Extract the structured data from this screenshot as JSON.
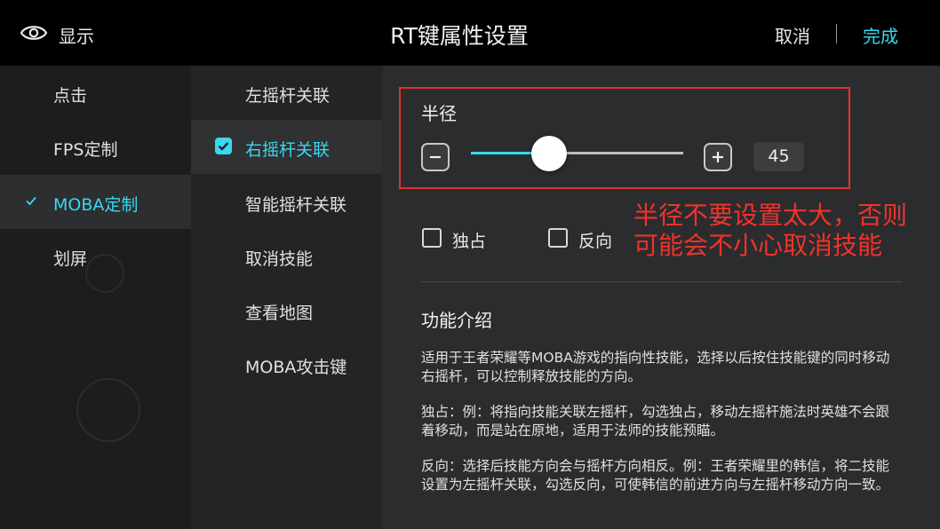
{
  "header": {
    "display_label": "显示",
    "title": "RT键属性设置",
    "cancel_label": "取消",
    "done_label": "完成",
    "accent_color": "#38d8ef"
  },
  "mode_list": {
    "items": [
      {
        "label": "点击",
        "selected": false
      },
      {
        "label": "FPS定制",
        "selected": false
      },
      {
        "label": "MOBA定制",
        "selected": true
      },
      {
        "label": "划屏",
        "selected": false
      }
    ]
  },
  "binding_list": {
    "items": [
      {
        "label": "左摇杆关联",
        "selected": false
      },
      {
        "label": "右摇杆关联",
        "selected": true
      },
      {
        "label": "智能摇杆关联",
        "selected": false
      },
      {
        "label": "取消技能",
        "selected": false
      },
      {
        "label": "查看地图",
        "selected": false
      },
      {
        "label": "MOBA攻击键",
        "selected": false
      }
    ]
  },
  "radius": {
    "label": "半径",
    "value": "45",
    "slider_fraction": 0.37,
    "minus_icon": "minus-icon",
    "plus_icon": "plus-icon"
  },
  "options": {
    "exclusive_label": "独占",
    "exclusive_checked": false,
    "reverse_label": "反向",
    "reverse_checked": false
  },
  "annotation": {
    "line1": "半径不要设置太大，否则",
    "line2": "可能会不小心取消技能",
    "color": "#f2322a"
  },
  "intro": {
    "title": "功能介绍",
    "p1": "适用于王者荣耀等MOBA游戏的指向性技能，选择以后按住技能键的同时移动右摇杆，可以控制释放技能的方向。",
    "p2": "独占：例：将指向技能关联左摇杆，勾选独占，移动左摇杆施法时英雄不会跟着移动，而是站在原地，适用于法师的技能预瞄。",
    "p3": "反向：选择后技能方向会与摇杆方向相反。例：王者荣耀里的韩信，将二技能设置为左摇杆关联，勾选反向，可使韩信的前进方向与左摇杆移动方向一致。"
  }
}
